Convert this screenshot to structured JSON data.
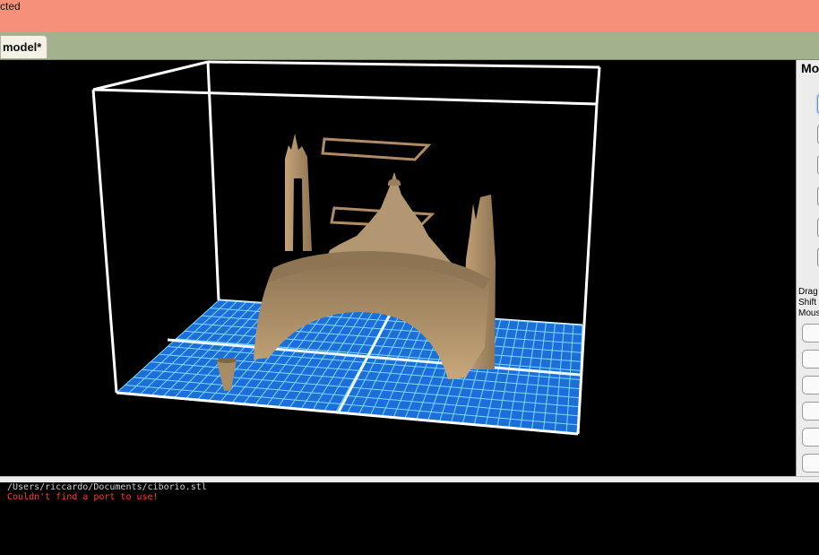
{
  "statusbar": {
    "text": "cted"
  },
  "tabs": [
    {
      "label": "model*"
    }
  ],
  "sidepanel": {
    "title": "Mo",
    "hints": [
      "Drag",
      "Shift",
      "Mous"
    ]
  },
  "console": {
    "lines": [
      {
        "text": "/Users/riccardo/Documents/ciborio.stl",
        "color": "#cfcfcf"
      },
      {
        "text": "Couldn't find a port to use!",
        "color": "#ff3b3b"
      }
    ]
  },
  "colors": {
    "status_bar": "#f7907a",
    "tab_strip": "#a3b28c",
    "build_plate": "#1c6fd9",
    "build_grid": "#7fd8ff",
    "model": "#a88c66",
    "bounding_box": "#ffffff"
  }
}
